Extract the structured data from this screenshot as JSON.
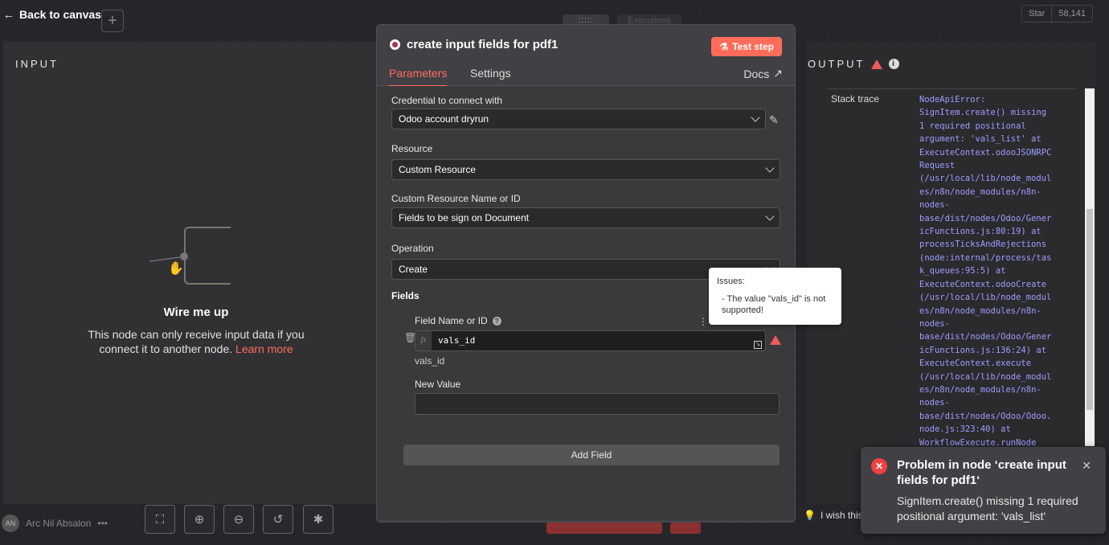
{
  "topbar": {
    "back_label": "Back to canvas",
    "plus": "+",
    "drag_handle": "::::: ",
    "exec_tab": "Executions",
    "github_star": "Star",
    "github_count": "58,141"
  },
  "input_panel": {
    "title": "INPUT",
    "wire_title": "Wire me up",
    "wire_text": "This node can only receive input data if you connect it to another node.",
    "learn_more": "Learn more"
  },
  "modal": {
    "title": "create input fields for pdf1",
    "test_step": "Test step",
    "tab_parameters": "Parameters",
    "tab_settings": "Settings",
    "docs": "Docs",
    "credential_label": "Credential to connect with",
    "credential_value": "Odoo account dryrun",
    "resource_label": "Resource",
    "resource_value": "Custom Resource",
    "custom_resource_label": "Custom Resource Name or ID",
    "custom_resource_value": "Fields to be sign on Document",
    "operation_label": "Operation",
    "operation_value": "Create",
    "fields_label": "Fields",
    "field_name_label": "Field Name or ID",
    "field_expr": "vals_id",
    "field_preview": "vals_id",
    "new_value_label": "New Value",
    "add_field": "Add Field",
    "issues_title": "Issues:",
    "issues_msg": "- The value \"vals_id\" is not supported!"
  },
  "output_panel": {
    "title": "OUTPUT",
    "stack_label": "Stack trace",
    "stack_trace": "NodeApiError:\nSignItem.create() missing\n1 required positional\nargument: 'vals_list' at\nExecuteContext.odooJSONRPC\nRequest\n(/usr/local/lib/node_modul\nes/n8n/node_modules/n8n-\nnodes-\nbase/dist/nodes/Odoo/Gener\nicFunctions.js:80:19) at\nprocessTicksAndRejections\n(node:internal/process/tas\nk_queues:95:5) at\nExecuteContext.odooCreate\n(/usr/local/lib/node_modul\nes/n8n/node_modules/n8n-\nnodes-\nbase/dist/nodes/Odoo/Gener\nicFunctions.js:136:24) at\nExecuteContext.execute\n(/usr/local/lib/node_modul\nes/n8n/node_modules/n8n-\nnodes-\nbase/dist/nodes/Odoo/Odoo.\nnode.js:323:40) at\nWorkflowExecute.runNode",
    "wish_text": "I wish this"
  },
  "toast": {
    "title": "Problem in node ‘create input fields for pdf1‘",
    "message": "SignItem.create() missing 1 required positional argument: 'vals_list'"
  },
  "user": {
    "initials": "AN",
    "name": "Arc Nil Absalon",
    "more": "•••"
  },
  "colors": {
    "accent": "#ff6d5a",
    "error": "#f04040",
    "trace": "#9d9dff"
  }
}
